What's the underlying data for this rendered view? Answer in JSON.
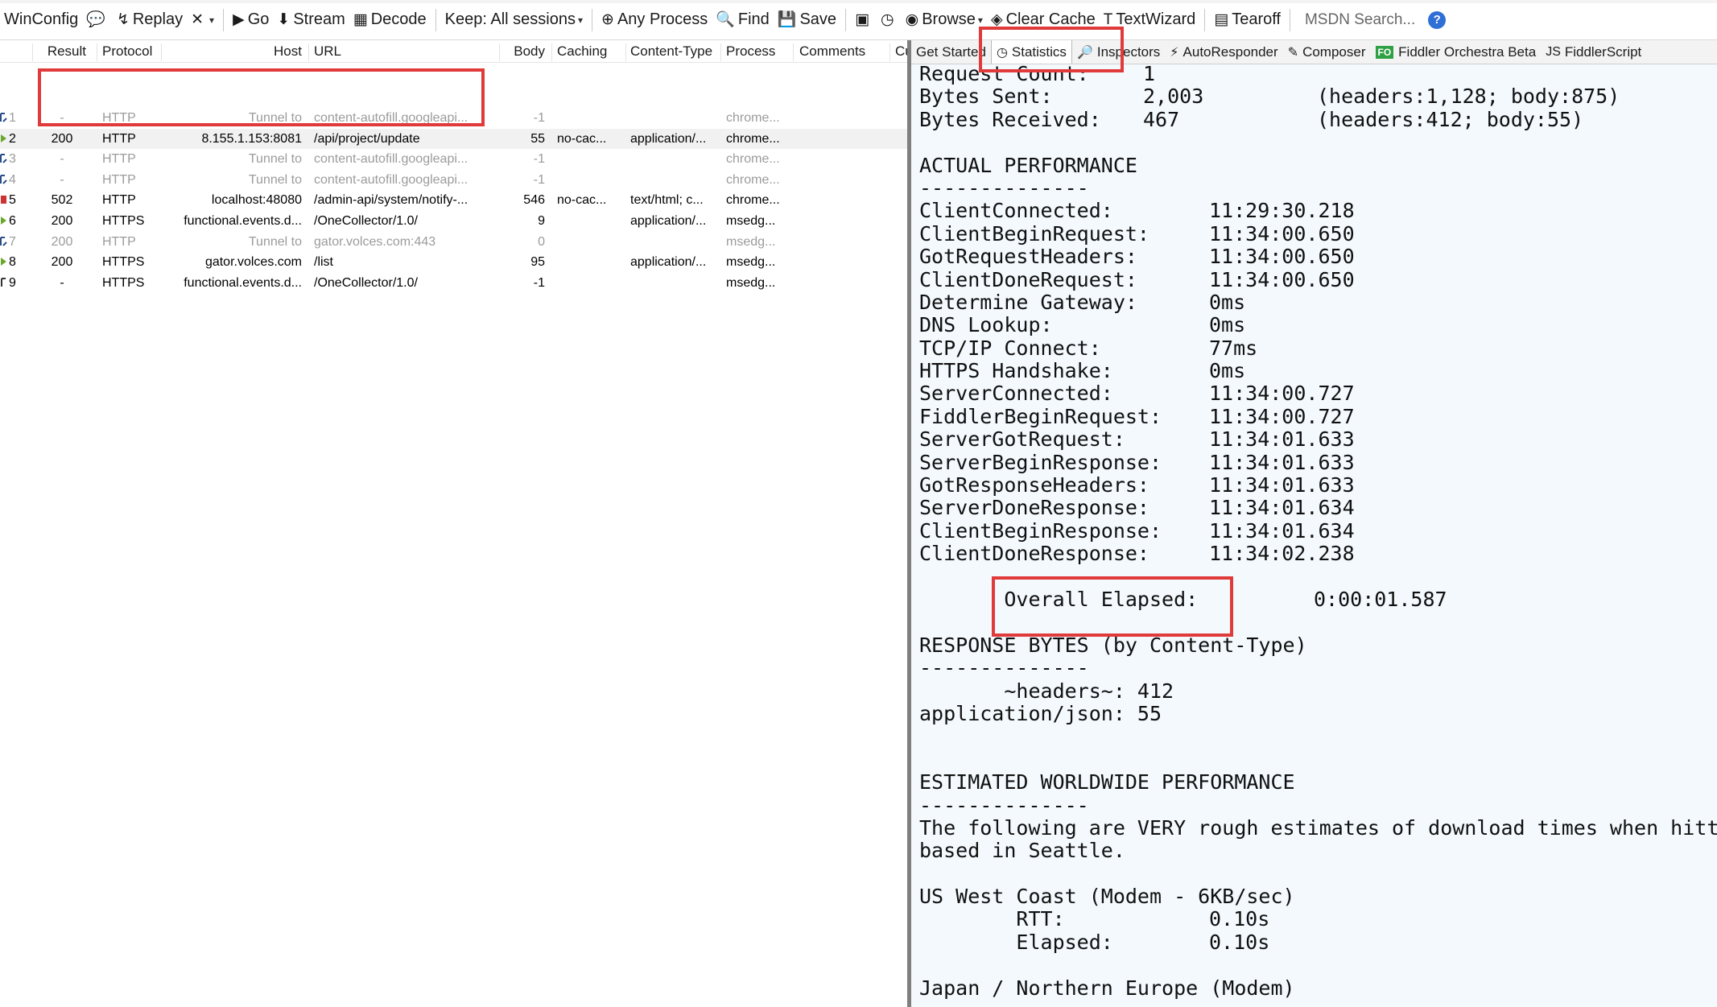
{
  "toolbar": {
    "items": [
      {
        "icon": "winconfig-icon",
        "glyph": "",
        "label": "WinConfig"
      },
      {
        "icon": "comment-icon",
        "glyph": "💬",
        "label": ""
      },
      {
        "icon": "replay-icon",
        "glyph": "↯",
        "label": "Replay"
      },
      {
        "icon": "remove-icon",
        "glyph": "✕",
        "label": "",
        "dropdown": true
      },
      {
        "icon": "go-icon",
        "glyph": "▶",
        "label": "Go"
      },
      {
        "icon": "stream-icon",
        "glyph": "⬇",
        "label": "Stream"
      },
      {
        "icon": "decode-icon",
        "glyph": "▦",
        "label": "Decode"
      },
      {
        "icon": "",
        "glyph": "",
        "label": "Keep: All sessions",
        "dropdown": true
      },
      {
        "icon": "any-process-icon",
        "glyph": "⊕",
        "label": "Any Process"
      },
      {
        "icon": "find-icon",
        "glyph": "🔍",
        "label": "Find"
      },
      {
        "icon": "save-icon",
        "glyph": "💾",
        "label": "Save"
      },
      {
        "icon": "screenshot-icon",
        "glyph": "▣",
        "label": ""
      },
      {
        "icon": "timer-icon",
        "glyph": "◷",
        "label": ""
      },
      {
        "icon": "browse-icon",
        "glyph": "◉",
        "label": "Browse",
        "dropdown": true
      },
      {
        "icon": "clear-cache-icon",
        "glyph": "◈",
        "label": "Clear Cache"
      },
      {
        "icon": "textwizard-icon",
        "glyph": "T",
        "label": "TextWizard"
      },
      {
        "icon": "tearoff-icon",
        "glyph": "▤",
        "label": "Tearoff"
      }
    ],
    "search_placeholder": "MSDN Search...",
    "help_glyph": "?"
  },
  "session_list": {
    "columns": [
      "Result",
      "Protocol",
      "Host",
      "URL",
      "Body",
      "Caching",
      "Content-Type",
      "Process",
      "Comments",
      "Cu"
    ],
    "rows": [
      {
        "num": "1",
        "result": "-",
        "protocol": "HTTP",
        "host": "Tunnel to",
        "url": "content-autofill.googleapi...",
        "body": "-1",
        "caching": "",
        "content_type": "",
        "process": "chrome...",
        "dim": true,
        "icon": "tunnel"
      },
      {
        "num": "2",
        "result": "200",
        "protocol": "HTTP",
        "host": "8.155.1.153:8081",
        "url": "/api/project/update",
        "body": "55",
        "caching": "no-cac...",
        "content_type": "application/...",
        "process": "chrome...",
        "dim": false,
        "icon": "json"
      },
      {
        "num": "3",
        "result": "-",
        "protocol": "HTTP",
        "host": "Tunnel to",
        "url": "content-autofill.googleapi...",
        "body": "-1",
        "caching": "",
        "content_type": "",
        "process": "chrome...",
        "dim": true,
        "icon": "tunnel"
      },
      {
        "num": "4",
        "result": "-",
        "protocol": "HTTP",
        "host": "Tunnel to",
        "url": "content-autofill.googleapi...",
        "body": "-1",
        "caching": "",
        "content_type": "",
        "process": "chrome...",
        "dim": true,
        "icon": "tunnel"
      },
      {
        "num": "5",
        "result": "502",
        "protocol": "HTTP",
        "host": "localhost:48080",
        "url": "/admin-api/system/notify-...",
        "body": "546",
        "caching": "no-cac...",
        "content_type": "text/html; c...",
        "process": "chrome...",
        "dim": false,
        "icon": "error"
      },
      {
        "num": "6",
        "result": "200",
        "protocol": "HTTPS",
        "host": "functional.events.d...",
        "url": "/OneCollector/1.0/",
        "body": "9",
        "caching": "",
        "content_type": "application/...",
        "process": "msedg...",
        "dim": false,
        "icon": "json"
      },
      {
        "num": "7",
        "result": "200",
        "protocol": "HTTP",
        "host": "Tunnel to",
        "url": "gator.volces.com:443",
        "body": "0",
        "caching": "",
        "content_type": "",
        "process": "msedg...",
        "dim": true,
        "icon": "tunnel"
      },
      {
        "num": "8",
        "result": "200",
        "protocol": "HTTPS",
        "host": "gator.volces.com",
        "url": "/list",
        "body": "95",
        "caching": "",
        "content_type": "application/...",
        "process": "msedg...",
        "dim": false,
        "icon": "json"
      },
      {
        "num": "9",
        "result": "-",
        "protocol": "HTTPS",
        "host": "functional.events.d...",
        "url": "/OneCollector/1.0/",
        "body": "-1",
        "caching": "",
        "content_type": "",
        "process": "msedg...",
        "dim": false,
        "icon": "pending"
      }
    ]
  },
  "tabs": [
    {
      "icon": "",
      "glyph": "",
      "label": "Get Started"
    },
    {
      "icon": "statistics-icon",
      "glyph": "◷",
      "label": "Statistics",
      "active": true
    },
    {
      "icon": "inspectors-icon",
      "glyph": "🔎",
      "label": "Inspectors"
    },
    {
      "icon": "autoresponder-icon",
      "glyph": "⚡",
      "label": "AutoResponder"
    },
    {
      "icon": "composer-icon",
      "glyph": "✎",
      "label": "Composer"
    },
    {
      "icon": "fiddler-orchestra-icon",
      "glyph": "FO",
      "label": "Fiddler Orchestra Beta"
    },
    {
      "icon": "fiddlerscript-icon",
      "glyph": "JS",
      "label": "FiddlerScript"
    }
  ],
  "statistics": {
    "lines": [
      {
        "label": "Request Count:",
        "value": "1",
        "extra": ""
      },
      {
        "label": "Bytes Sent:",
        "value": "2,003",
        "extra": "(headers:1,128; body:875)"
      },
      {
        "label": "Bytes Received:",
        "value": "467",
        "extra": "(headers:412; body:55)"
      },
      {
        "label": "",
        "value": "",
        "extra": ""
      },
      {
        "label": "ACTUAL PERFORMANCE",
        "value": "",
        "extra": ""
      },
      {
        "label": "--------------",
        "value": "",
        "extra": ""
      },
      {
        "label": "ClientConnected:",
        "value": "11:29:30.218",
        "extra": ""
      },
      {
        "label": "ClientBeginRequest:",
        "value": "11:34:00.650",
        "extra": ""
      },
      {
        "label": "GotRequestHeaders:",
        "value": "11:34:00.650",
        "extra": ""
      },
      {
        "label": "ClientDoneRequest:",
        "value": "11:34:00.650",
        "extra": ""
      },
      {
        "label": "Determine Gateway:",
        "value": "0ms",
        "extra": ""
      },
      {
        "label": "DNS Lookup:",
        "value": "0ms",
        "extra": ""
      },
      {
        "label": "TCP/IP Connect:",
        "value": "77ms",
        "extra": ""
      },
      {
        "label": "HTTPS Handshake:",
        "value": "0ms",
        "extra": ""
      },
      {
        "label": "ServerConnected:",
        "value": "11:34:00.727",
        "extra": ""
      },
      {
        "label": "FiddlerBeginRequest:",
        "value": "11:34:00.727",
        "extra": ""
      },
      {
        "label": "ServerGotRequest:",
        "value": "11:34:01.633",
        "extra": ""
      },
      {
        "label": "ServerBeginResponse:",
        "value": "11:34:01.633",
        "extra": ""
      },
      {
        "label": "GotResponseHeaders:",
        "value": "11:34:01.633",
        "extra": ""
      },
      {
        "label": "ServerDoneResponse:",
        "value": "11:34:01.634",
        "extra": ""
      },
      {
        "label": "ClientBeginResponse:",
        "value": "11:34:01.634",
        "extra": ""
      },
      {
        "label": "ClientDoneResponse:",
        "value": "11:34:02.238",
        "extra": ""
      },
      {
        "label": "",
        "value": "",
        "extra": ""
      },
      {
        "label": "       Overall Elapsed:",
        "value": "",
        "extra": "0:00:01.587"
      },
      {
        "label": "",
        "value": "",
        "extra": ""
      },
      {
        "label": "RESPONSE BYTES (by Content-Type)",
        "value": "",
        "extra": ""
      },
      {
        "label": "--------------",
        "value": "",
        "extra": ""
      },
      {
        "label": "       ~headers~: 412",
        "value": "",
        "extra": ""
      },
      {
        "label": "application/json: 55",
        "value": "",
        "extra": ""
      },
      {
        "label": "",
        "value": "",
        "extra": ""
      },
      {
        "label": "",
        "value": "",
        "extra": ""
      },
      {
        "label": "ESTIMATED WORLDWIDE PERFORMANCE",
        "value": "",
        "extra": ""
      },
      {
        "label": "--------------",
        "value": "",
        "extra": ""
      },
      {
        "label": "The following are VERY rough estimates of download times when hitting servers",
        "value": "",
        "extra": ""
      },
      {
        "label": "based in Seattle.",
        "value": "",
        "extra": ""
      },
      {
        "label": "",
        "value": "",
        "extra": ""
      },
      {
        "label": "US West Coast (Modem - 6KB/sec)",
        "value": "",
        "extra": ""
      },
      {
        "label": "        RTT:",
        "value": "0.10s",
        "extra": ""
      },
      {
        "label": "        Elapsed:",
        "value": "0.10s",
        "extra": ""
      },
      {
        "label": "",
        "value": "",
        "extra": ""
      },
      {
        "label": "Japan / Northern Europe (Modem)",
        "value": "",
        "extra": ""
      }
    ]
  },
  "colors": {
    "annotation_red": "#e03a3a",
    "stats_background": "#f3f9fd",
    "selected_row": "#f1f1f1",
    "dim_text": "#9b9b9b"
  }
}
